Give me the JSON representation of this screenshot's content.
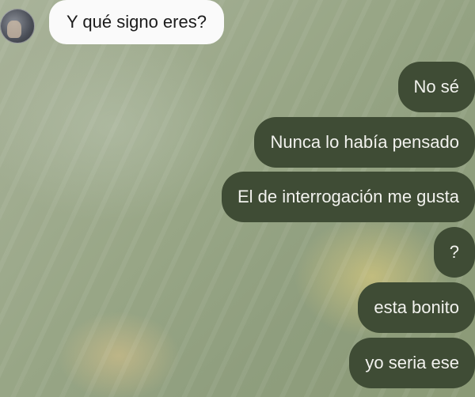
{
  "conversation": {
    "incoming_message": "Y qué signo eres?",
    "outgoing_messages": [
      "No sé",
      "Nunca lo había pensado",
      "El de interrogación me gusta",
      "?",
      "esta bonito",
      "yo seria ese"
    ]
  },
  "colors": {
    "incoming_bubble": "#fafafa",
    "outgoing_bubble": "#3f4c35",
    "background": "#98a686"
  }
}
